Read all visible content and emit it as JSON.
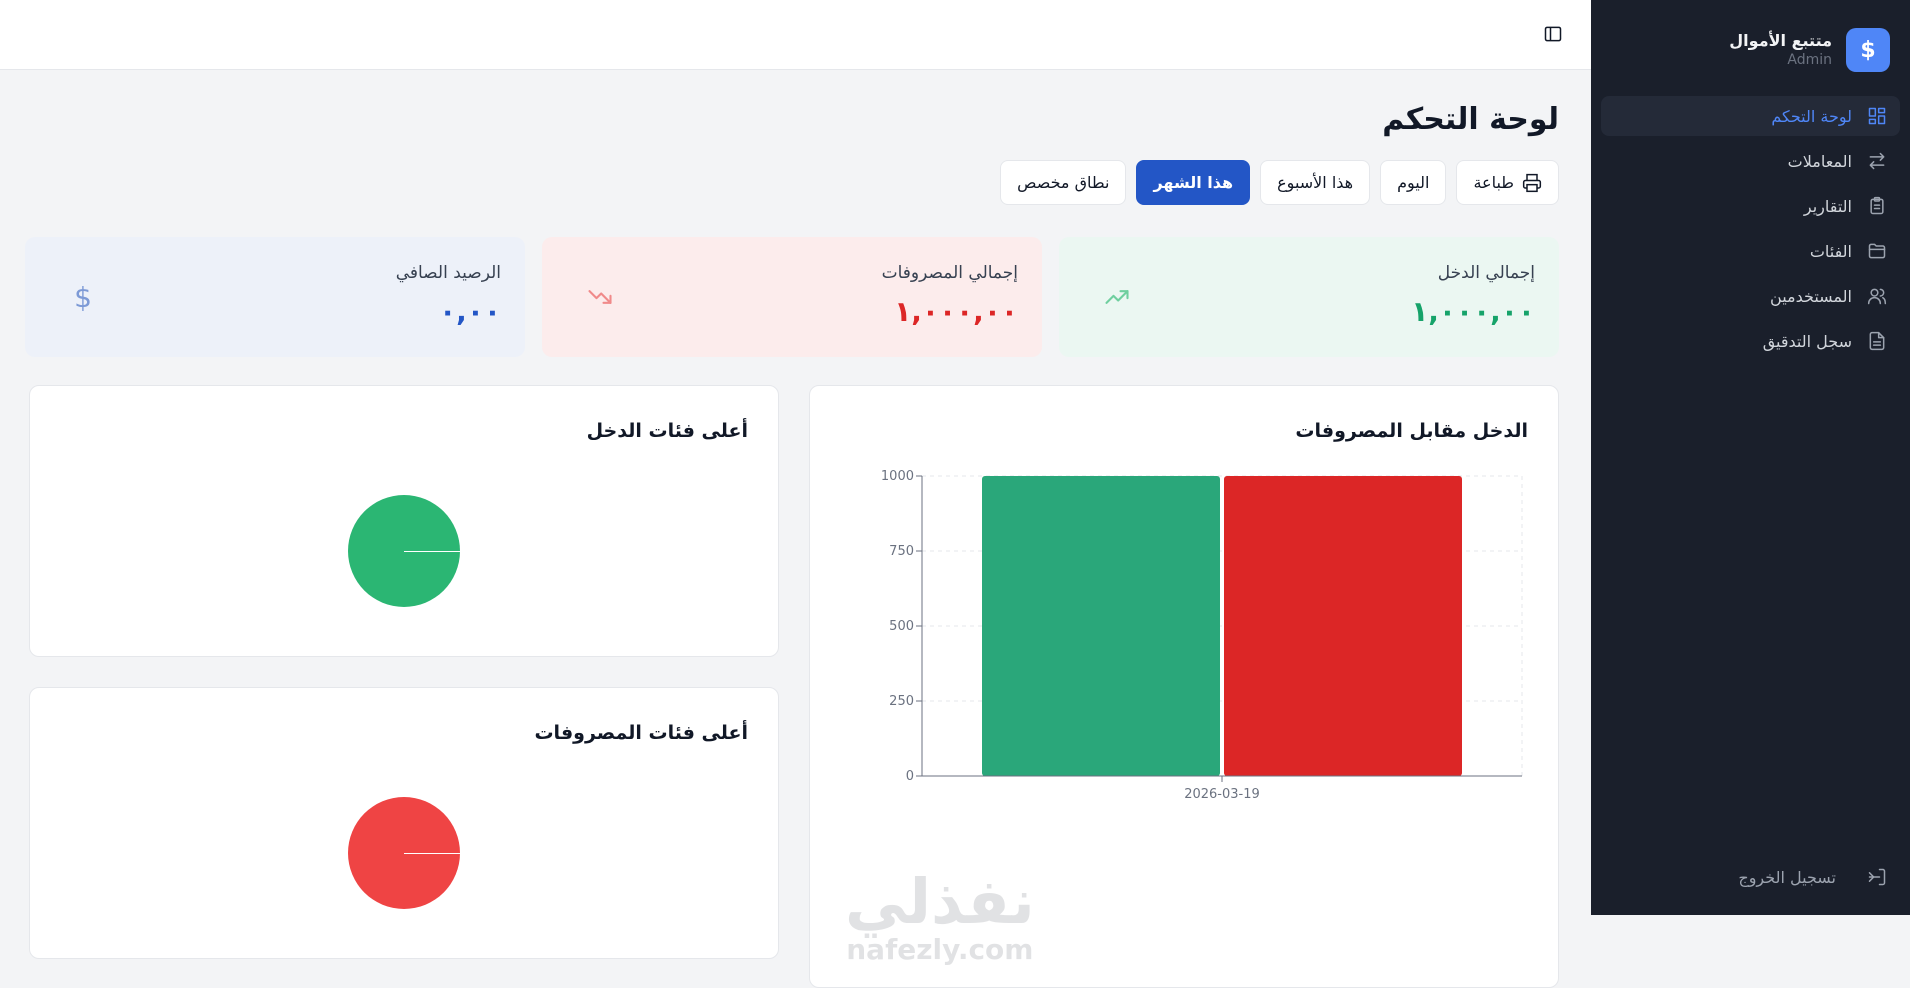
{
  "app": {
    "name": "متتبع الأموال",
    "role": "Admin",
    "logo_symbol": "$"
  },
  "sidebar": {
    "items": [
      {
        "label": "لوحة التحكم",
        "icon": "dashboard-icon",
        "active": true
      },
      {
        "label": "المعاملات",
        "icon": "transfer-arrows-icon",
        "active": false
      },
      {
        "label": "التقارير",
        "icon": "clipboard-icon",
        "active": false
      },
      {
        "label": "الفئات",
        "icon": "folder-icon",
        "active": false
      },
      {
        "label": "المستخدمين",
        "icon": "users-icon",
        "active": false
      },
      {
        "label": "سجل التدقيق",
        "icon": "file-text-icon",
        "active": false
      }
    ],
    "logout_label": "تسجيل الخروج"
  },
  "page": {
    "title": "لوحة التحكم"
  },
  "filters": {
    "print_label": "طباعة",
    "today_label": "اليوم",
    "week_label": "هذا الأسبوع",
    "month_label": "هذا الشهر",
    "custom_label": "نطاق مخصص",
    "active": "هذا الشهر"
  },
  "stats": {
    "income": {
      "label": "إجمالي الدخل",
      "value": "١,٠٠٠,٠٠"
    },
    "expense": {
      "label": "إجمالي المصروفات",
      "value": "١,٠٠٠,٠٠"
    },
    "balance": {
      "label": "الرصيد الصافي",
      "value": "٠,٠٠",
      "symbol": "$"
    }
  },
  "panels": {
    "bar_title": "الدخل مقابل المصروفات",
    "income_categories_title": "أعلى فئات الدخل",
    "expense_categories_title": "أعلى فئات المصروفات"
  },
  "chart_data": [
    {
      "type": "bar",
      "title": "الدخل مقابل المصروفات",
      "categories": [
        "2026-03-19"
      ],
      "series": [
        {
          "values": [
            1000
          ],
          "color": "#2aa77a"
        },
        {
          "values": [
            1000
          ],
          "color": "#dc2626"
        }
      ],
      "ylim": [
        0,
        1000
      ],
      "yticks": [
        "0",
        "250",
        "500",
        "750",
        "1000"
      ],
      "grid": true
    },
    {
      "type": "pie",
      "title": "أعلى فئات الدخل",
      "values": [
        100
      ],
      "colors": [
        "#2bb673"
      ]
    },
    {
      "type": "pie",
      "title": "أعلى فئات المصروفات",
      "values": [
        100
      ],
      "colors": [
        "#ef4444"
      ]
    }
  ],
  "watermark": {
    "arabic": "نفذلي",
    "latin": "nafezly.com"
  },
  "colors": {
    "accent": "#4f86f7",
    "primary_button": "#2356c6",
    "sidebar_bg": "#1a1f2b",
    "income": "#16a36a",
    "expense": "#dc2626"
  }
}
